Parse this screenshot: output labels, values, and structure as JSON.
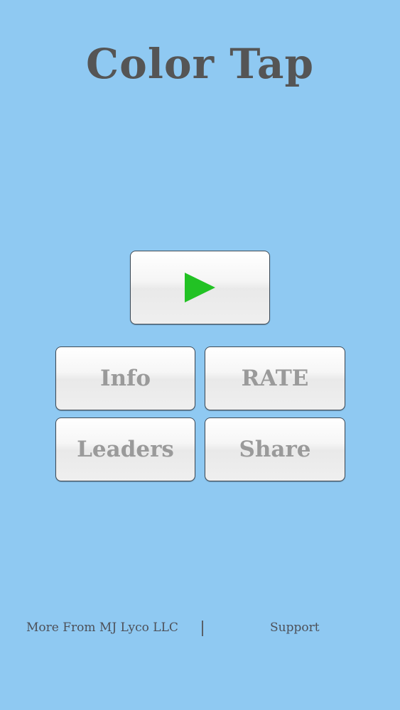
{
  "app": {
    "title": "Color Tap"
  },
  "menu": {
    "play_icon": "play-icon",
    "play_color": "#22c224",
    "info_label": "Info",
    "rate_label": "RATE",
    "leaders_label": "Leaders",
    "share_label": "Share"
  },
  "footer": {
    "more_label": "More From MJ Lyco LLC",
    "support_label": "Support"
  },
  "colors": {
    "background": "#8fc9f2",
    "title": "#555555",
    "button_text": "#9a9a9a"
  }
}
